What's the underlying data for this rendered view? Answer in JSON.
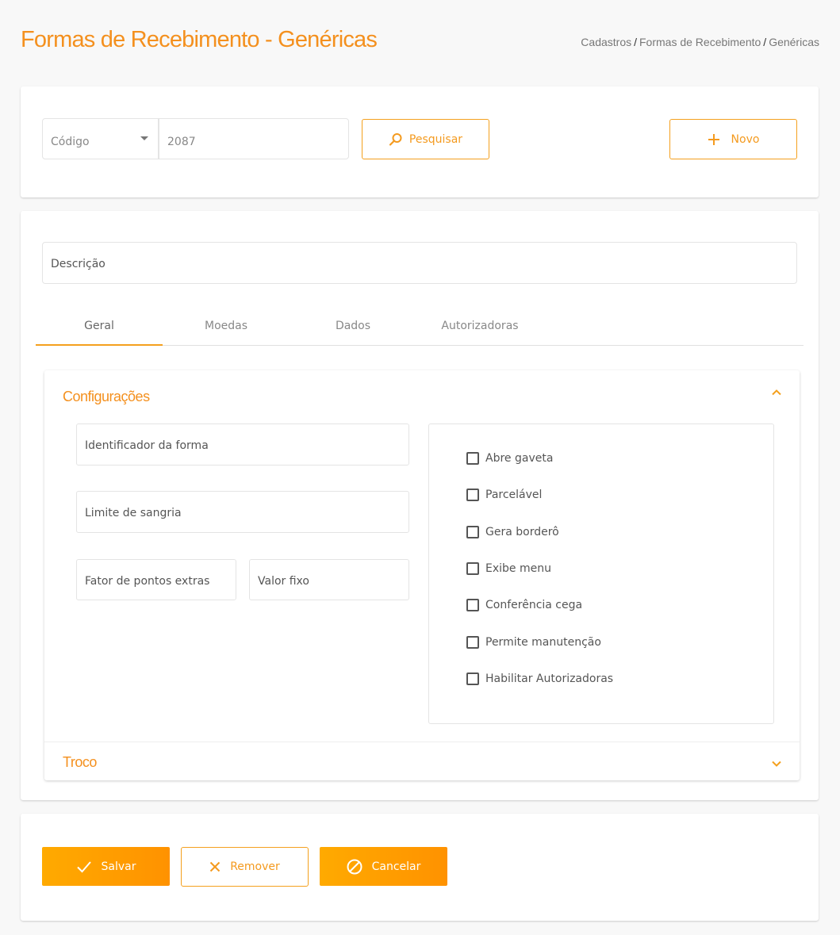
{
  "header": {
    "title": "Formas de Recebimento - Genéricas",
    "breadcrumb": [
      "Cadastros",
      "Formas de Recebimento",
      "Genéricas"
    ]
  },
  "search": {
    "field_select": "Código",
    "code_value": "2087",
    "search_label": "Pesquisar",
    "new_label": "Novo"
  },
  "form": {
    "description_placeholder": "Descrição",
    "tabs": [
      {
        "label": "Geral",
        "active": true
      },
      {
        "label": "Moedas",
        "active": false
      },
      {
        "label": "Dados",
        "active": false
      },
      {
        "label": "Autorizadoras",
        "active": false
      }
    ],
    "config": {
      "title": "Configurações",
      "identifier_placeholder": "Identificador da forma",
      "limit_placeholder": "Limite de sangria",
      "factor_placeholder": "Fator de pontos extras",
      "fixed_placeholder": "Valor fixo",
      "checks": [
        {
          "label": "Abre gaveta",
          "checked": false
        },
        {
          "label": "Parcelável",
          "checked": false
        },
        {
          "label": "Gera borderô",
          "checked": false
        },
        {
          "label": "Exibe menu",
          "checked": false
        },
        {
          "label": "Conferência cega",
          "checked": false
        },
        {
          "label": "Permite manutenção",
          "checked": false
        },
        {
          "label": "Habilitar Autorizadoras",
          "checked": false
        }
      ]
    },
    "troco": {
      "title": "Troco"
    }
  },
  "actions": {
    "save_label": "Salvar",
    "remove_label": "Remover",
    "cancel_label": "Cancelar"
  },
  "colors": {
    "accent": "#f4901e",
    "accent_gradient_start": "#ffaa00",
    "accent_gradient_end": "#ff9200"
  }
}
